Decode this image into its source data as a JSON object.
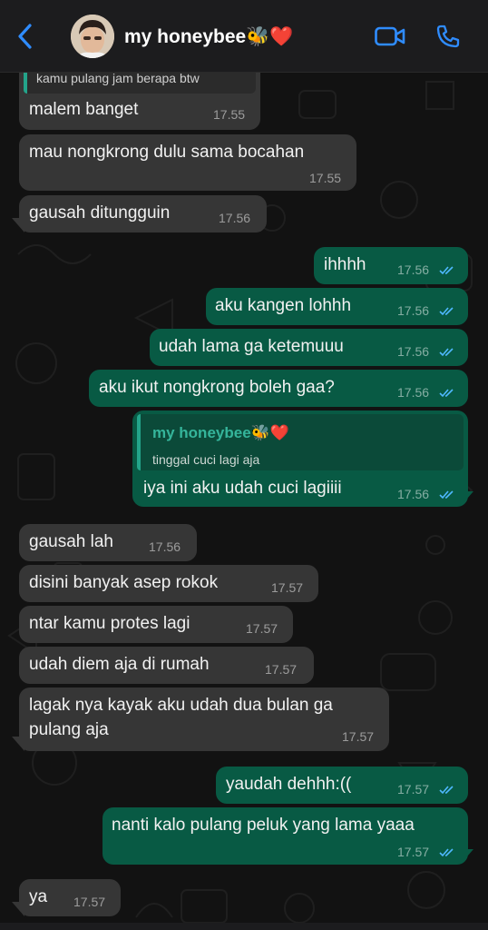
{
  "header": {
    "title": "my honeybee🐝❤️",
    "accent_color": "#2f8cff",
    "icons": [
      "back-chevron-icon",
      "video-call-icon",
      "phone-call-icon"
    ]
  },
  "messages": [
    {
      "dir": "in",
      "quote_text": "kamu pulang jam berapa btw",
      "text": "malem banget",
      "time": "17.55"
    },
    {
      "dir": "in",
      "text": "mau nongkrong dulu sama bocahan",
      "time": "17.55"
    },
    {
      "dir": "in",
      "text": "gausah ditungguin",
      "time": "17.56"
    },
    {
      "dir": "out",
      "text": "ihhhh",
      "time": "17.56"
    },
    {
      "dir": "out",
      "text": "aku kangen lohhh",
      "time": "17.56"
    },
    {
      "dir": "out",
      "text": "udah lama ga ketemuuu",
      "time": "17.56"
    },
    {
      "dir": "out",
      "text": "aku ikut nongkrong boleh gaa?",
      "time": "17.56"
    },
    {
      "dir": "out",
      "quote_name": "my honeybee🐝❤️",
      "quote_text": "tinggal cuci lagi aja",
      "text": "iya ini aku udah cuci lagiiii",
      "time": "17.56"
    },
    {
      "dir": "in",
      "text": "gausah lah",
      "time": "17.56"
    },
    {
      "dir": "in",
      "text": "disini banyak asep rokok",
      "time": "17.57"
    },
    {
      "dir": "in",
      "text": "ntar kamu protes lagi",
      "time": "17.57"
    },
    {
      "dir": "in",
      "text": "udah diem aja di rumah",
      "time": "17.57"
    },
    {
      "dir": "in",
      "text_line1": "lagak nya kayak aku udah dua bulan ga",
      "text_line2": "pulang aja",
      "time": "17.57"
    },
    {
      "dir": "out",
      "text": "yaudah dehhh:((",
      "time": "17.57"
    },
    {
      "dir": "out",
      "text": "nanti kalo pulang peluk yang lama yaaa",
      "time": "17.57"
    },
    {
      "dir": "in",
      "text": "ya",
      "time": "17.57"
    }
  ],
  "colors": {
    "incoming_bubble": "#363636",
    "outgoing_bubble": "#085a44",
    "read_ticks": "#4fb8ff"
  }
}
